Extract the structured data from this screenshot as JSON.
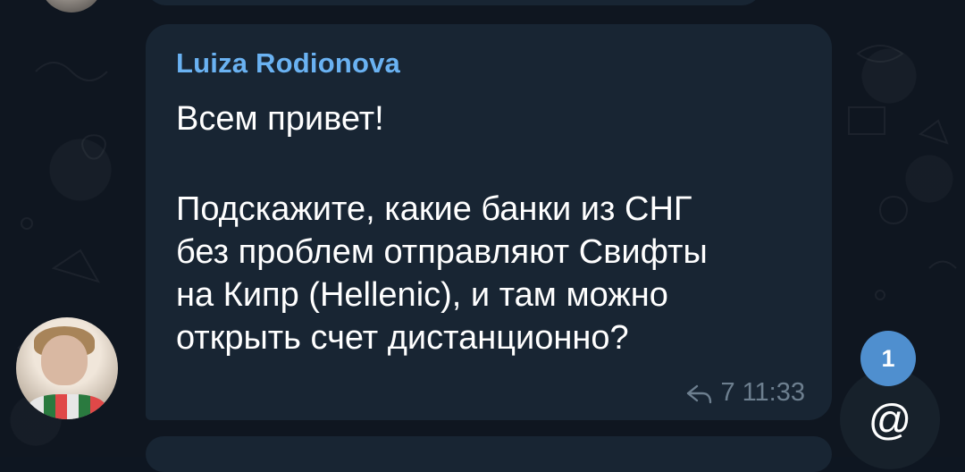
{
  "message": {
    "sender": "Luiza Rodionova",
    "greeting": "Всем привет!",
    "lines": [
      "Подскажите, какие банки из СНГ",
      "без проблем отправляют Свифты",
      "на Кипр (Hellenic), и там можно",
      "открыть счет дистанционно?"
    ],
    "replies_count": "7",
    "time": "11:33"
  },
  "mentions": {
    "icon_glyph": "@",
    "unread_count": "1"
  },
  "colors": {
    "background": "#0e1621",
    "bubble": "#182533",
    "sender_name": "#6ab2f2",
    "meta": "#6d7f8f",
    "badge": "#4f8fcf"
  },
  "icons": [
    "reply-arrow-icon",
    "mention-icon"
  ]
}
